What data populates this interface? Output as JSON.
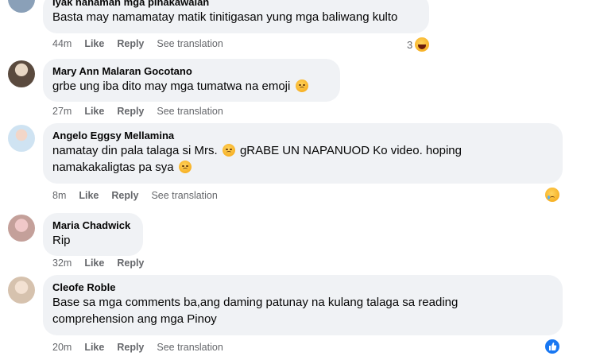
{
  "colors": {
    "bubble": "#f0f2f5",
    "meta": "#65676b",
    "like_blue": "#1877f2"
  },
  "labels": {
    "like": "Like",
    "reply": "Reply",
    "see_translation": "See translation"
  },
  "comments": [
    {
      "author": "Iyak nanaman mga pinakawalan",
      "text": "Basta may namamatay matik tinitigasan yung mga baliwang kulto",
      "time": "44m",
      "reaction_count": "3",
      "reaction_icon": "haha-icon"
    },
    {
      "author": "Mary Ann Malaran Gocotano",
      "text": "grbe ung iba dito may mga tumatwa na emoji",
      "time": "27m"
    },
    {
      "author": "Angelo Eggsy Mellamina",
      "text_line1_a": "namatay din pala talaga si Mrs.",
      "text_line1_b": "gRABE UN NAPANUOD Ko video. hoping",
      "text_line2": "namakakaligtas pa sya",
      "time": "8m",
      "reaction_icon": "sad-icon"
    },
    {
      "author": "Maria Chadwick",
      "text": "Rip",
      "time": "32m"
    },
    {
      "author": "Cleofe Roble",
      "text_line1": "Base sa mga comments ba,ang daming patunay na kulang talaga sa reading",
      "text_line2": "comprehension ang mga Pinoy",
      "time": "20m",
      "reaction_icon": "like-icon"
    }
  ]
}
